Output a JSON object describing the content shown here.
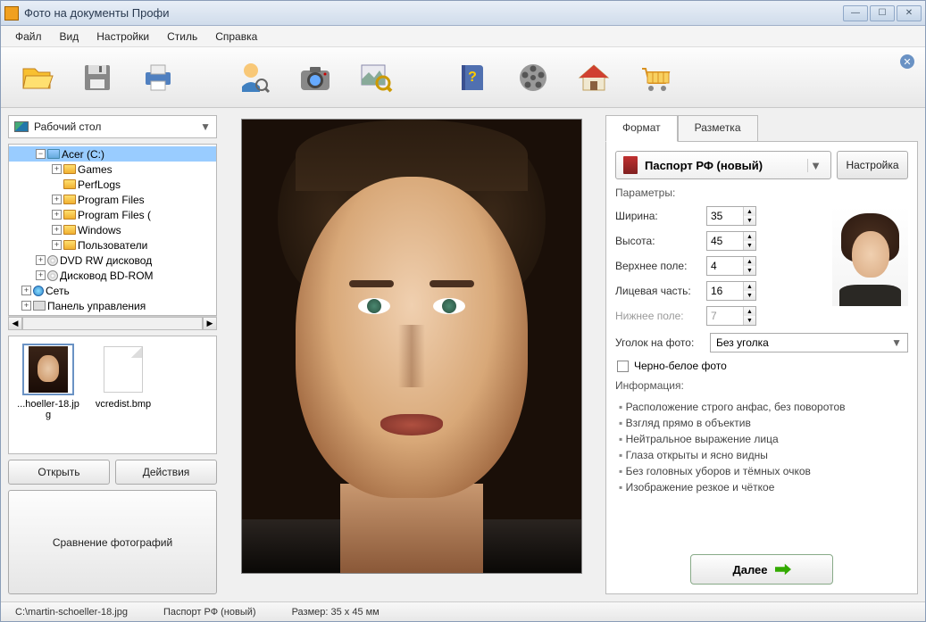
{
  "title": "Фото на документы Профи",
  "menu": [
    "Файл",
    "Вид",
    "Настройки",
    "Стиль",
    "Справка"
  ],
  "location": "Рабочий стол",
  "tree": {
    "acer": "Acer (C:)",
    "games": "Games",
    "perflogs": "PerfLogs",
    "progfiles": "Program Files",
    "progfilesx": "Program Files (",
    "windows": "Windows",
    "users": "Пользователи",
    "dvd": "DVD RW дисковод",
    "bd": "Дисковод BD-ROM",
    "network": "Сеть",
    "control": "Панель управления"
  },
  "thumbs": {
    "file1": "...hoeller-18.jpg",
    "file2": "vcredist.bmp"
  },
  "buttons": {
    "open": "Открыть",
    "actions": "Действия",
    "compare": "Сравнение фотографий",
    "settings": "Настройка",
    "next": "Далее"
  },
  "tabs": {
    "format": "Формат",
    "markup": "Разметка"
  },
  "format": {
    "selected": "Паспорт РФ (новый)",
    "params_title": "Параметры:",
    "width_label": "Ширина:",
    "width": "35",
    "height_label": "Высота:",
    "height": "45",
    "top_label": "Верхнее поле:",
    "top": "4",
    "face_label": "Лицевая часть:",
    "face": "16",
    "bottom_label": "Нижнее поле:",
    "bottom": "7",
    "corner_label": "Уголок на фото:",
    "corner_value": "Без уголка",
    "bw_label": "Черно-белое фото",
    "info_title": "Информация:",
    "info": [
      "Расположение строго анфас, без поворотов",
      "Взгляд прямо в объектив",
      "Нейтральное выражение лица",
      "Глаза открыты и ясно видны",
      "Без головных уборов и тёмных очков",
      "Изображение резкое и чёткое"
    ]
  },
  "status": {
    "path": "C:\\martin-schoeller-18.jpg",
    "format": "Паспорт РФ (новый)",
    "size": "Размер: 35 x 45 мм"
  }
}
